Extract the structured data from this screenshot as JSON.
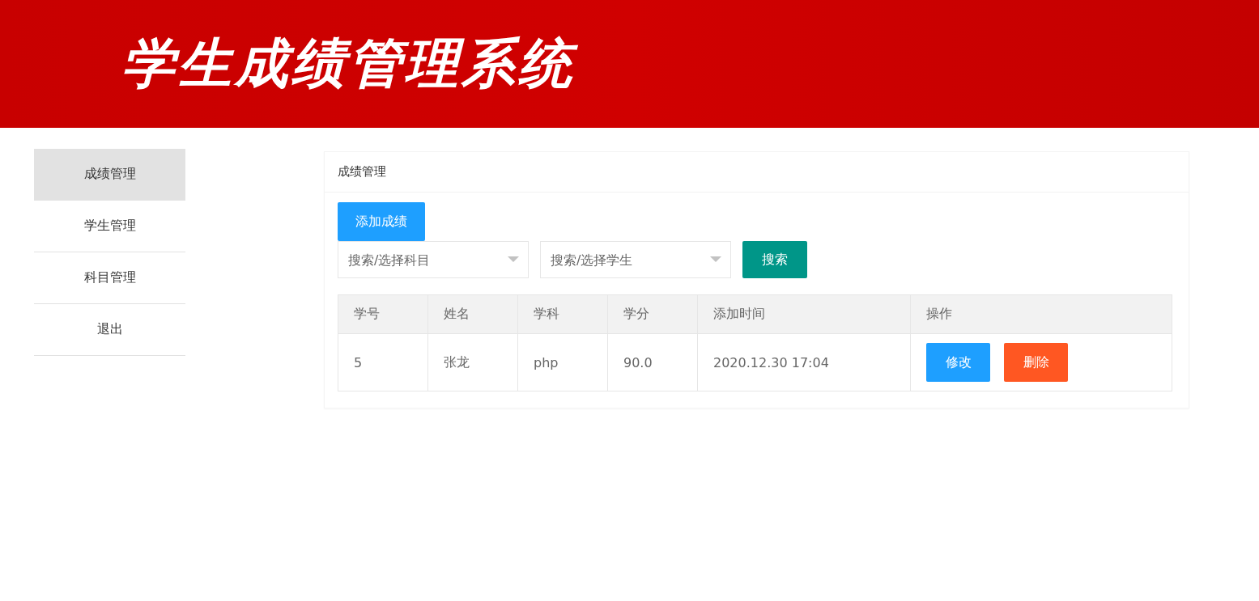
{
  "header": {
    "title": "学生成绩管理系统"
  },
  "sidebar": {
    "items": [
      {
        "label": "成绩管理",
        "selected": true
      },
      {
        "label": "学生管理",
        "selected": false
      },
      {
        "label": "科目管理",
        "selected": false
      },
      {
        "label": "退出",
        "selected": false
      }
    ]
  },
  "panel": {
    "title": "成绩管理",
    "add_button": "添加成绩",
    "filters": [
      {
        "placeholder": "搜索/选择科目"
      },
      {
        "placeholder": "搜索/选择学生"
      }
    ],
    "search_button": "搜索",
    "table": {
      "columns": [
        "学号",
        "姓名",
        "学科",
        "学分",
        "添加时间",
        "操作"
      ],
      "rows": [
        {
          "cells": [
            "5",
            "张龙",
            "php",
            "90.0",
            "2020.12.30 17:04"
          ],
          "actions": [
            {
              "label": "修改",
              "kind": "edit"
            },
            {
              "label": "删除",
              "kind": "delete"
            }
          ]
        }
      ]
    }
  }
}
